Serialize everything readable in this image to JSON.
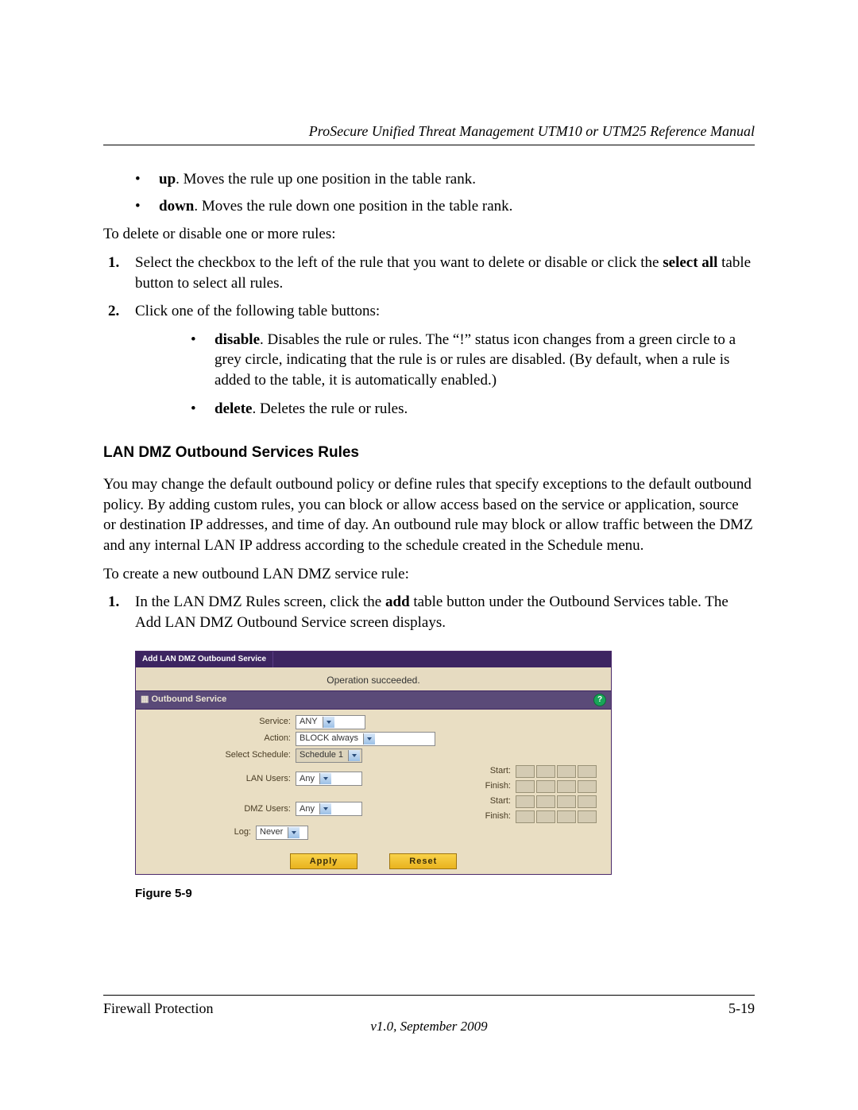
{
  "header": {
    "running_title": "ProSecure Unified Threat Management UTM10 or UTM25 Reference Manual"
  },
  "body": {
    "bullets_top": [
      {
        "term": "up",
        "text": ". Moves the rule up one position in the table rank."
      },
      {
        "term": "down",
        "text": ". Moves the rule down one position in the table rank."
      }
    ],
    "delete_intro": "To delete or disable one or more rules:",
    "numbered_a": [
      {
        "num": "1.",
        "pre": "Select the checkbox to the left of the rule that you want to delete or disable or click the ",
        "bold": "select all",
        "post": " table button to select all rules."
      },
      {
        "num": "2.",
        "text": "Click one of the following table buttons:"
      }
    ],
    "sub_bullets": [
      {
        "term": "disable",
        "text": ". Disables the rule or rules. The “!” status icon changes from a green circle to a grey circle, indicating that the rule is or rules are disabled. (By default, when a rule is added to the table, it is automatically enabled.)"
      },
      {
        "term": "delete",
        "text": ". Deletes the rule or rules."
      }
    ],
    "section_heading": "LAN DMZ Outbound Services Rules",
    "section_para": "You may change the default outbound policy or define rules that specify exceptions to the default outbound policy. By adding custom rules, you can block or allow access based on the service or application, source or destination IP addresses, and time of day. An outbound rule may block or allow traffic between the DMZ and any internal LAN IP address according to the schedule created in the Schedule menu.",
    "create_intro": "To create a new outbound LAN DMZ service rule:",
    "numbered_b": [
      {
        "num": "1.",
        "pre": "In the LAN DMZ Rules screen, click the ",
        "bold": "add",
        "post": " table button under the Outbound Services table. The Add LAN DMZ Outbound Service screen displays."
      }
    ]
  },
  "figure": {
    "tab_label": "Add LAN DMZ Outbound Service",
    "status": "Operation succeeded.",
    "section_title": "Outbound Service",
    "help": "?",
    "fields": {
      "service_label": "Service:",
      "service_value": "ANY",
      "action_label": "Action:",
      "action_value": "BLOCK always",
      "schedule_label": "Select Schedule:",
      "schedule_value": "Schedule 1",
      "lan_label": "LAN Users:",
      "lan_value": "Any",
      "dmz_label": "DMZ Users:",
      "dmz_value": "Any",
      "log_label": "Log:",
      "log_value": "Never",
      "start_label": "Start:",
      "finish_label": "Finish:"
    },
    "buttons": {
      "apply": "Apply",
      "reset": "Reset"
    },
    "caption": "Figure 5-9"
  },
  "footer": {
    "left": "Firewall Protection",
    "right": "5-19",
    "version": "v1.0, September 2009"
  }
}
